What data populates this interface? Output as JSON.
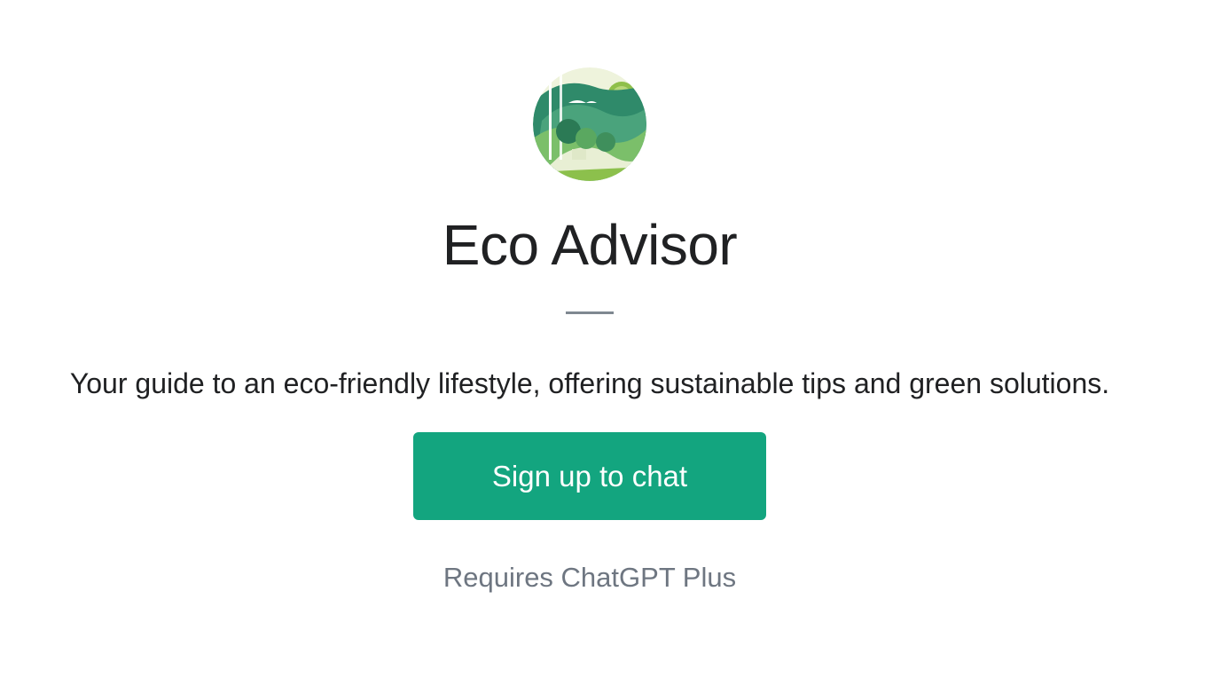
{
  "gpt": {
    "avatar_icon": "eco-landscape-avatar",
    "name": "Eco Advisor",
    "description": "Your guide to an eco-friendly lifestyle, offering sustainable tips and green solutions."
  },
  "cta": {
    "signup_label": "Sign up to chat"
  },
  "footer": {
    "requirement_text": "Requires ChatGPT Plus"
  },
  "colors": {
    "primary_button": "#13a57f",
    "title_text": "#202123",
    "muted_text": "#6e7681",
    "divider": "#7f8891"
  }
}
